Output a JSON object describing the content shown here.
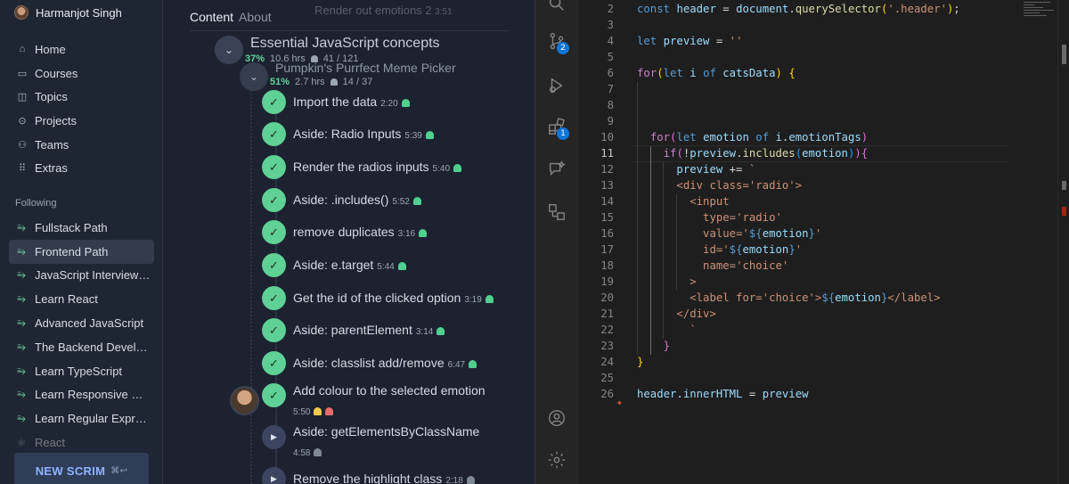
{
  "sidebar": {
    "user_name": "Harmanjot Singh",
    "nav": [
      {
        "label": "Home",
        "icon": "home-icon",
        "glyph": "⌂"
      },
      {
        "label": "Courses",
        "icon": "courses-icon",
        "glyph": "▭"
      },
      {
        "label": "Topics",
        "icon": "topics-icon",
        "glyph": "◫"
      },
      {
        "label": "Projects",
        "icon": "projects-icon",
        "glyph": "⊙"
      },
      {
        "label": "Teams",
        "icon": "teams-icon",
        "glyph": "⚇"
      },
      {
        "label": "Extras",
        "icon": "extras-icon",
        "glyph": "⠿"
      }
    ],
    "following_label": "Following",
    "following": [
      {
        "label": "Fullstack Path"
      },
      {
        "label": "Frontend Path"
      },
      {
        "label": "JavaScript Interview ..."
      },
      {
        "label": "Learn React"
      },
      {
        "label": "Advanced JavaScript"
      },
      {
        "label": "The Backend Develo..."
      },
      {
        "label": "Learn TypeScript"
      },
      {
        "label": "Learn Responsive W..."
      },
      {
        "label": "Learn Regular Expre..."
      },
      {
        "label": "React"
      }
    ],
    "new_scrim": "NEW SCRIM",
    "new_scrim_kbd": "⌘↩"
  },
  "content": {
    "tabs": [
      "Content",
      "About"
    ],
    "ghost_top": "Render out emotions 2",
    "ghost_top_time": "3:51",
    "section": {
      "title": "Essential JavaScript concepts",
      "pct": "37%",
      "hours": "10.6 hrs",
      "count": "41 / 121"
    },
    "subsection": {
      "title": "Pumpkin's Purrfect Meme Picker",
      "pct": "51%",
      "hours": "2.7 hrs",
      "count": "14 / 37"
    },
    "lessons": [
      {
        "title": "Import the data",
        "dur": "2:20",
        "done": true
      },
      {
        "title": "Aside: Radio Inputs",
        "dur": "5:39",
        "done": true
      },
      {
        "title": "Render the radios inputs",
        "dur": "5:40",
        "done": true
      },
      {
        "title": "Aside: .includes()",
        "dur": "5:52",
        "done": true
      },
      {
        "title": "remove duplicates",
        "dur": "3:16",
        "done": true
      },
      {
        "title": "Aside: e.target",
        "dur": "5:44",
        "done": true
      },
      {
        "title": "Get the id of the clicked option",
        "dur": "3:19",
        "done": true
      },
      {
        "title": "Aside: parentElement",
        "dur": "3:14",
        "done": true
      },
      {
        "title": "Aside: classlist add/remove",
        "dur": "6:47",
        "done": true
      },
      {
        "title": "Add colour to the selected emotion",
        "dur": "5:50",
        "done": true
      },
      {
        "title": "Aside: getElementsByClassName",
        "dur": "4:58",
        "done": false
      },
      {
        "title": "Remove the highlight class",
        "dur": "2:18",
        "done": false
      }
    ]
  },
  "editor": {
    "lines": [
      {
        "n": "2",
        "html": "<span class=\"kw\">const</span> <span class=\"var\">header</span> = <span class=\"var\">document</span>.<span class=\"fn\">querySelector</span><span class=\"punc\">(</span><span class=\"str\">'.header'</span><span class=\"punc\">)</span>;"
      },
      {
        "n": "3",
        "html": ""
      },
      {
        "n": "4",
        "html": "<span class=\"kw\">let</span> <span class=\"var\">preview</span> = <span class=\"str\">''</span>"
      },
      {
        "n": "5",
        "html": ""
      },
      {
        "n": "6",
        "html": "<span class=\"kw2\">for</span><span class=\"punc\">(</span><span class=\"kw\">let</span> <span class=\"var\">i</span> <span class=\"kw\">of</span> <span class=\"var\">catsData</span><span class=\"punc\">)</span> <span class=\"punc\">{</span>"
      },
      {
        "n": "7",
        "html": ""
      },
      {
        "n": "8",
        "html": ""
      },
      {
        "n": "9",
        "html": ""
      },
      {
        "n": "10",
        "html": "  <span class=\"kw2\">for</span><span class=\"punc2\">(</span><span class=\"kw\">let</span> <span class=\"var\">emotion</span> <span class=\"kw\">of</span> <span class=\"var\">i</span>.<span class=\"var\">emotionTags</span><span class=\"punc2\">)</span>"
      },
      {
        "n": "11",
        "html": "    <span class=\"kw2\">if</span><span class=\"punc2\">(</span>!<span class=\"var\">preview</span>.<span class=\"fn\">includes</span><span class=\"punc3\">(</span><span class=\"var\">emotion</span><span class=\"punc3\">)</span><span class=\"punc2\">)</span><span class=\"punc2\">{</span>"
      },
      {
        "n": "12",
        "html": "      <span class=\"var\">preview</span> += <span class=\"str\">`</span>"
      },
      {
        "n": "13",
        "html": "      <span class=\"tag\">&lt;div class='radio'&gt;</span>"
      },
      {
        "n": "14",
        "html": "        <span class=\"tag\">&lt;input</span>"
      },
      {
        "n": "15",
        "html": "          <span class=\"tag\">type='radio'</span>"
      },
      {
        "n": "16",
        "html": "          <span class=\"tag\">value='</span><span class=\"kw\">${</span><span class=\"var\">emotion</span><span class=\"kw\">}</span><span class=\"tag\">'</span>"
      },
      {
        "n": "17",
        "html": "          <span class=\"tag\">id='</span><span class=\"kw\">${</span><span class=\"var\">emotion</span><span class=\"kw\">}</span><span class=\"tag\">'</span>"
      },
      {
        "n": "18",
        "html": "          <span class=\"tag\">name='choice'</span>"
      },
      {
        "n": "19",
        "html": "        <span class=\"tag\">&gt;</span>"
      },
      {
        "n": "20",
        "html": "        <span class=\"tag\">&lt;label for='choice'&gt;</span><span class=\"kw\">${</span><span class=\"var\">emotion</span><span class=\"kw\">}</span><span class=\"tag\">&lt;/label&gt;</span>"
      },
      {
        "n": "21",
        "html": "      <span class=\"tag\">&lt;/div&gt;</span>"
      },
      {
        "n": "22",
        "html": "        <span class=\"str\">`</span>"
      },
      {
        "n": "23",
        "html": "    <span class=\"punc2\">}</span>"
      },
      {
        "n": "24",
        "html": "<span class=\"punc\">}</span>"
      },
      {
        "n": "25",
        "html": ""
      },
      {
        "n": "26",
        "html": "<span class=\"var\">header</span>.<span class=\"var\">innerHTML</span> = <span class=\"var\">preview</span>"
      }
    ],
    "current_line": "11",
    "activity_badges": {
      "source_control": "2",
      "extensions": "1"
    }
  }
}
